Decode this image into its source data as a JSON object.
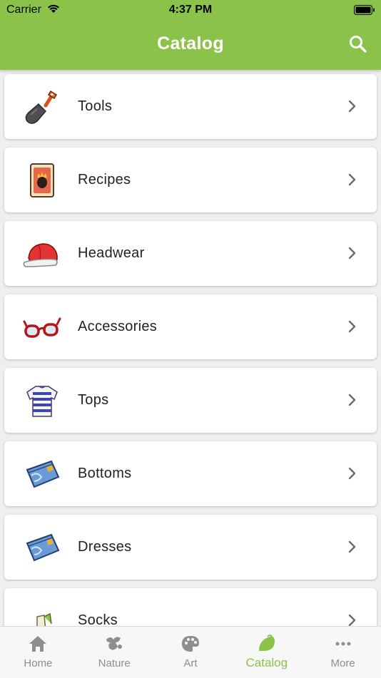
{
  "status": {
    "carrier": "Carrier",
    "time": "4:37 PM"
  },
  "header": {
    "title": "Catalog"
  },
  "colors": {
    "accent": "#8bc34a",
    "tab_inactive": "#8e8e8e",
    "text": "#222222"
  },
  "catalog": {
    "items": [
      {
        "label": "Tools",
        "icon": "shovel-icon"
      },
      {
        "label": "Recipes",
        "icon": "recipe-card-icon"
      },
      {
        "label": "Headwear",
        "icon": "cap-icon"
      },
      {
        "label": "Accessories",
        "icon": "glasses-icon"
      },
      {
        "label": "Tops",
        "icon": "striped-shirt-icon"
      },
      {
        "label": "Bottoms",
        "icon": "jeans-icon"
      },
      {
        "label": "Dresses",
        "icon": "jeans-icon"
      },
      {
        "label": "Socks",
        "icon": "socks-icon"
      }
    ]
  },
  "tabs": [
    {
      "label": "Home",
      "icon": "home-icon",
      "active": false
    },
    {
      "label": "Nature",
      "icon": "leaf-bug-icon",
      "active": false
    },
    {
      "label": "Art",
      "icon": "palette-icon",
      "active": false
    },
    {
      "label": "Catalog",
      "icon": "leaf-icon",
      "active": true
    },
    {
      "label": "More",
      "icon": "more-dots-icon",
      "active": false
    }
  ]
}
